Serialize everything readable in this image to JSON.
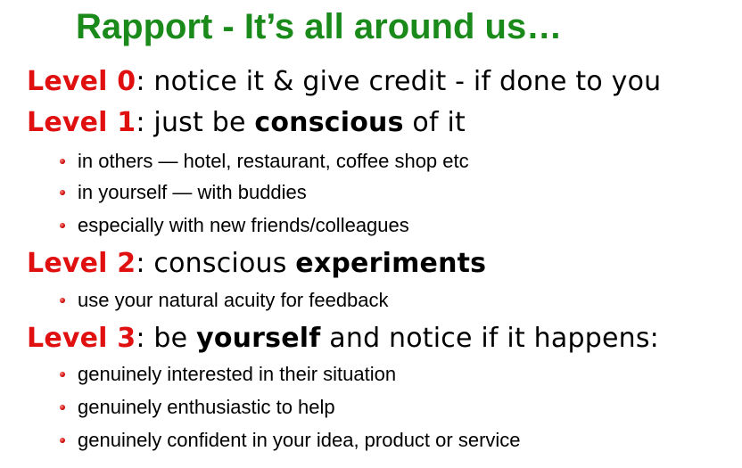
{
  "title": "Rapport - It’s all around us…",
  "colors": {
    "title": "#1a8a1a",
    "level_label": "#e01010",
    "bullet": "#d41010",
    "text": "#000000"
  },
  "levels": [
    {
      "label": "Level 0",
      "text_before": ": notice it & give credit - if done to you",
      "emphasis": "",
      "text_after": ""
    },
    {
      "label": "Level 1",
      "text_before": ": just be ",
      "emphasis": "conscious",
      "text_after": " of it",
      "bullets": [
        "in others — hotel, restaurant, coffee shop etc",
        "in yourself — with buddies",
        "especially with new friends/colleagues"
      ]
    },
    {
      "label": "Level 2",
      "text_before": ": conscious ",
      "emphasis": "experiments",
      "text_after": "",
      "bullets": [
        "use your natural acuity for feedback"
      ]
    },
    {
      "label": "Level 3",
      "text_before": ": be ",
      "emphasis": "yourself",
      "text_after": " and notice if it happens:",
      "bullets": [
        "genuinely interested in their situation",
        "genuinely enthusiastic to help",
        "genuinely confident in your idea, product or service"
      ]
    }
  ]
}
